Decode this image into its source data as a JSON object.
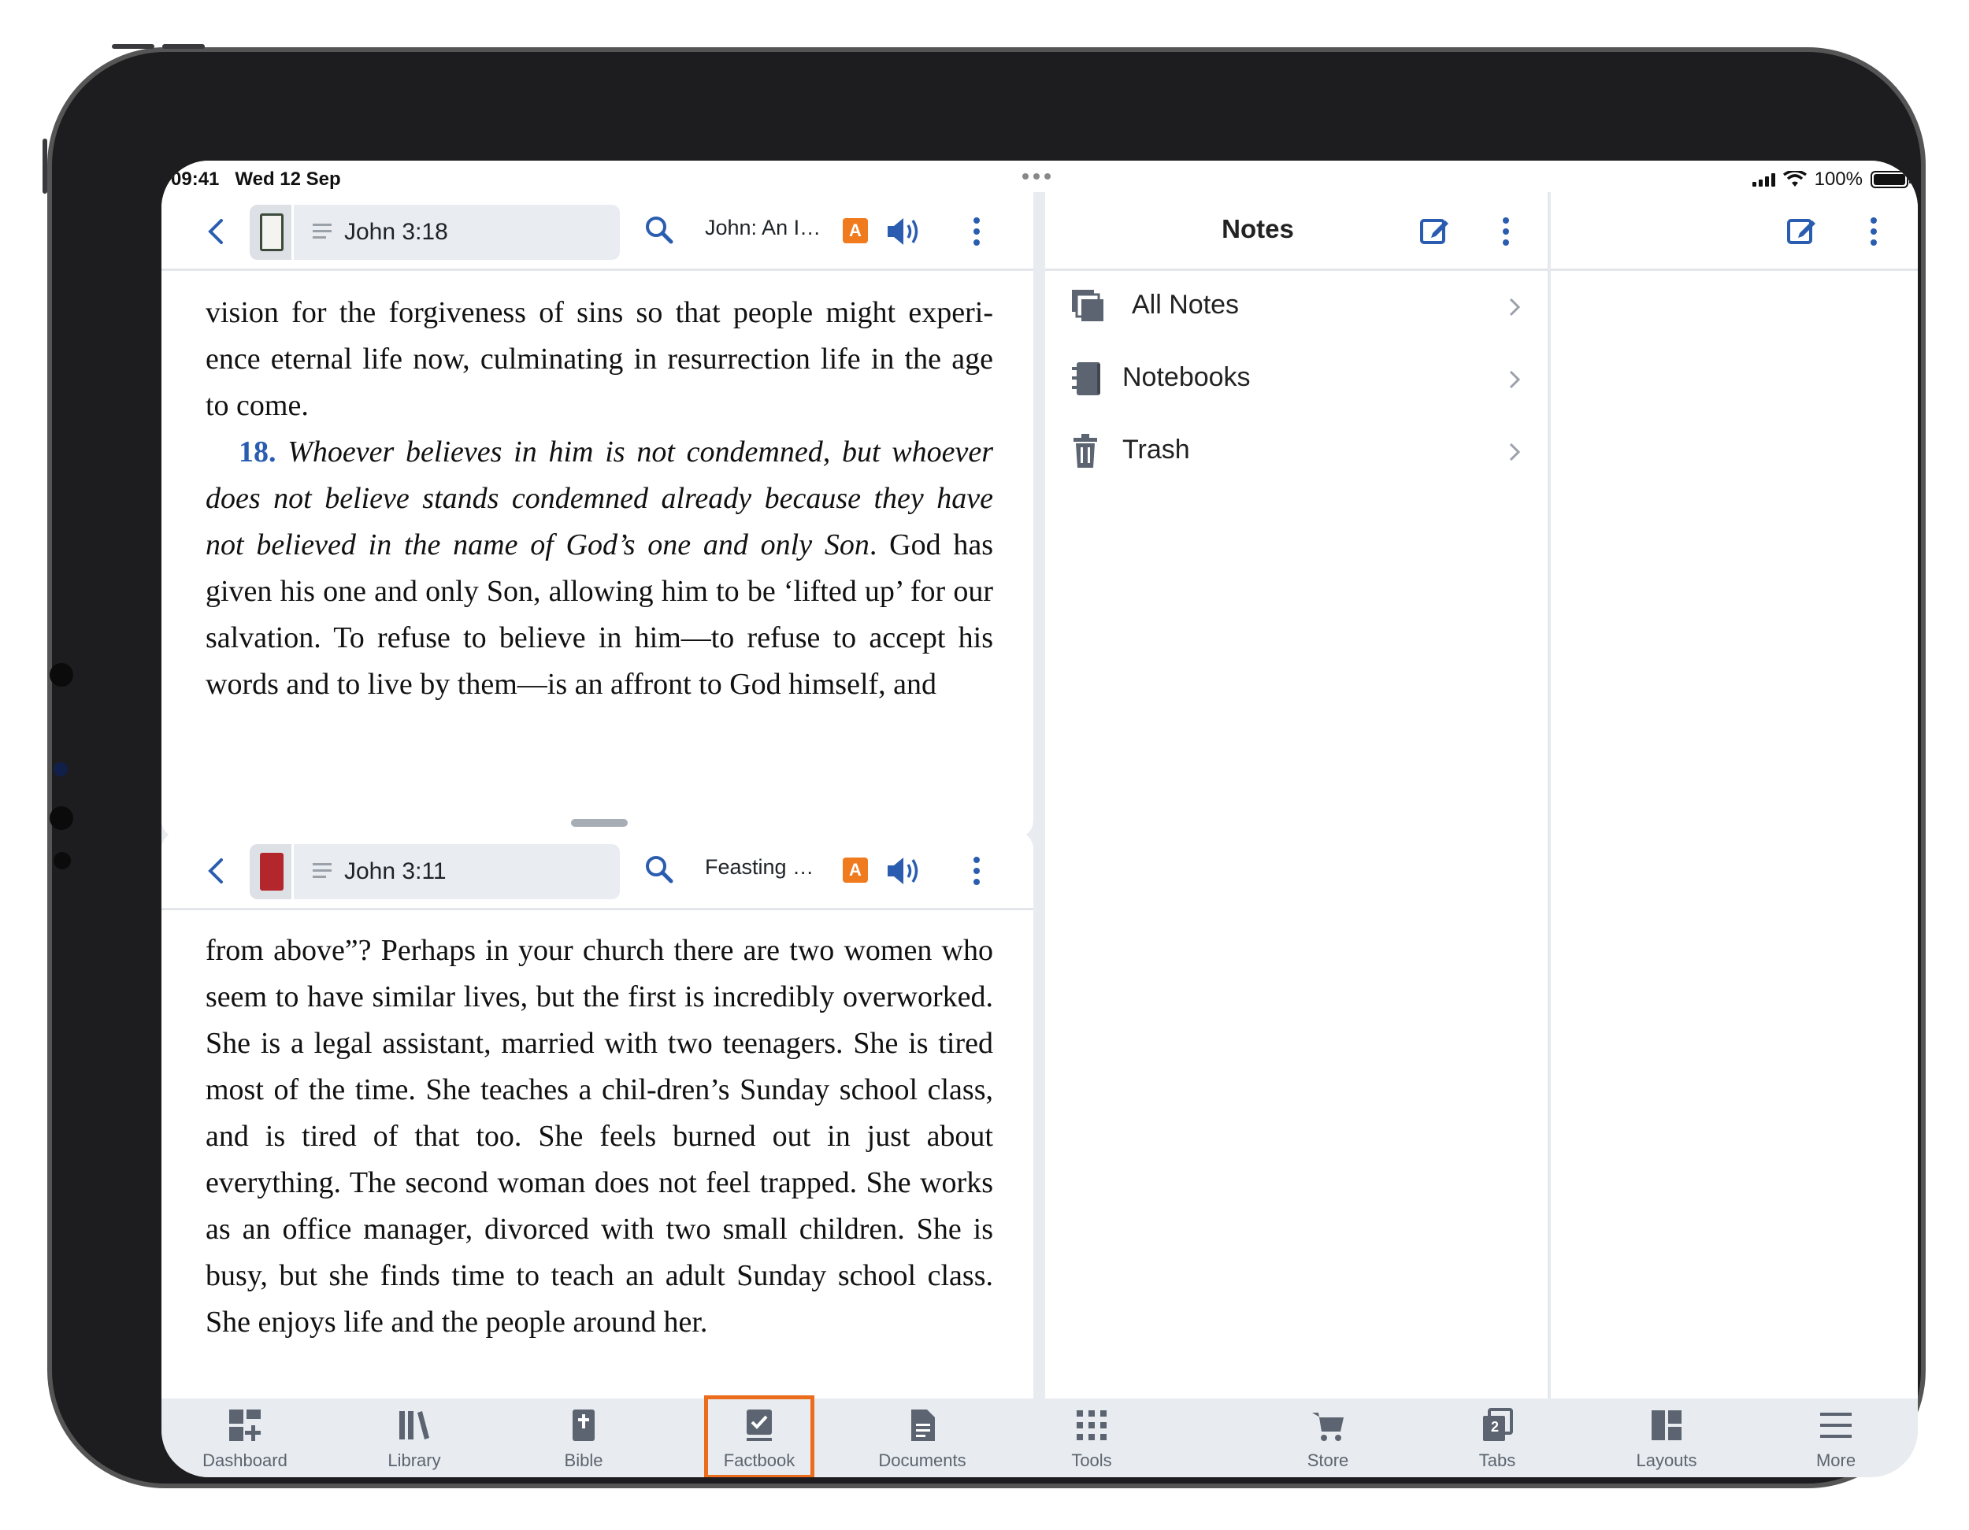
{
  "status": {
    "time": "09:41",
    "date": "Wed 12 Sep",
    "battery": "100%"
  },
  "top_pane": {
    "reference": "John 3:18",
    "resource_title": "John: An I…",
    "audio_badge": "A",
    "paragraph1": "vision for the forgiveness of sins so that people might experi-ence eternal life now, culminating in resurrection life in the age to come.",
    "verse_number": "18.",
    "verse_italic": "Whoever believes in him is not condemned, but whoever does not believe stands condemned already because they have not believed in the name of God’s one and only Son",
    "paragraph2_rest": ". God has given his one and only Son, allowing him to be ‘lifted up’ for our salvation. To refuse to believe in him—to refuse to accept his words and to live by them—is an affront to God himself, and"
  },
  "bottom_pane": {
    "reference": "John 3:11",
    "resource_title": "Feasting o…",
    "audio_badge": "A",
    "paragraph": "from above”? Perhaps in your church there are two women who seem to have similar lives, but the first is incredibly overworked. She is a legal assistant, married with two teenagers. She is tired most of the time. She teaches a chil-dren’s Sunday school class, and is tired of that too. She feels burned out in just about everything. The second woman does not feel trapped. She works as an office manager, divorced with two small children. She is busy, but she finds time to teach an adult Sunday school class. She enjoys life and the people around her."
  },
  "notes": {
    "title": "Notes",
    "items": [
      {
        "label": "All Notes",
        "icon": "stacked-notes-icon"
      },
      {
        "label": "Notebooks",
        "icon": "notebook-icon"
      },
      {
        "label": "Trash",
        "icon": "trash-icon"
      }
    ]
  },
  "tabbar": {
    "items": [
      {
        "label": "Dashboard",
        "icon": "dashboard-icon"
      },
      {
        "label": "Library",
        "icon": "library-icon"
      },
      {
        "label": "Bible",
        "icon": "bible-icon"
      },
      {
        "label": "Factbook",
        "icon": "factbook-icon",
        "highlighted": true
      },
      {
        "label": "Documents",
        "icon": "documents-icon"
      },
      {
        "label": "Tools",
        "icon": "tools-grid-icon"
      },
      {
        "label": "Store",
        "icon": "cart-icon"
      },
      {
        "label": "Tabs",
        "icon": "tabs-icon",
        "badge": "2"
      },
      {
        "label": "Layouts",
        "icon": "layouts-icon"
      },
      {
        "label": "More",
        "icon": "menu-icon"
      }
    ],
    "highlight_color": "#ea6c1c"
  },
  "colors": {
    "accent": "#2a5db0",
    "audio_badge": "#f07a1e",
    "icon_gray": "#5b6470"
  }
}
